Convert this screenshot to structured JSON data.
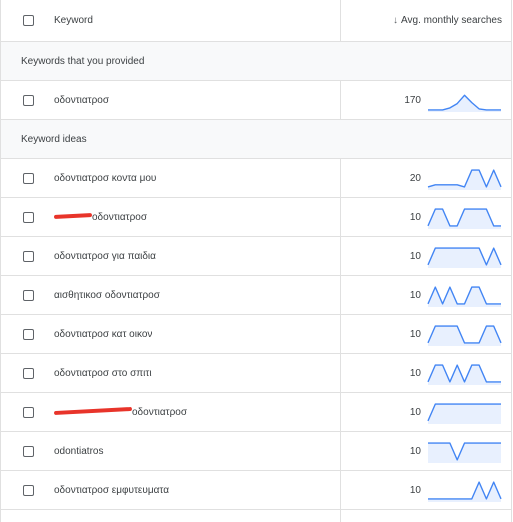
{
  "header": {
    "keyword_label": "Keyword",
    "sort_icon": "arrow-down-icon",
    "volume_label": "Avg. monthly searches"
  },
  "groups": [
    {
      "label": "Keywords that you provided"
    },
    {
      "label": "Keyword ideas"
    }
  ],
  "rows": [
    {
      "keyword": "οδοντιατροσ",
      "volume": "170",
      "trend": [
        0.05,
        0.05,
        0.05,
        0.15,
        0.35,
        0.75,
        0.4,
        0.1,
        0.05,
        0.05,
        0.05
      ]
    },
    {
      "keyword": "οδοντιατροσ κοντα μου",
      "volume": "20",
      "trend": [
        0.1,
        0.2,
        0.2,
        0.2,
        0.2,
        0.1,
        0.9,
        0.9,
        0.1,
        0.9,
        0.1
      ]
    },
    {
      "keyword": "οδοντιατροσ",
      "redacted": true,
      "volume": "10",
      "trend": [
        0.1,
        0.9,
        0.9,
        0.1,
        0.1,
        0.9,
        0.9,
        0.9,
        0.9,
        0.1,
        0.1
      ]
    },
    {
      "keyword": "οδοντιατροσ για παιδια",
      "volume": "10",
      "trend": [
        0.1,
        0.9,
        0.9,
        0.9,
        0.9,
        0.9,
        0.9,
        0.9,
        0.1,
        0.9,
        0.1
      ]
    },
    {
      "keyword": "αισθητικοσ οδοντιατροσ",
      "volume": "10",
      "trend": [
        0.1,
        0.9,
        0.1,
        0.9,
        0.1,
        0.1,
        0.9,
        0.9,
        0.1,
        0.1,
        0.1
      ]
    },
    {
      "keyword": "οδοντιατροσ κατ οικον",
      "volume": "10",
      "trend": [
        0.1,
        0.9,
        0.9,
        0.9,
        0.9,
        0.1,
        0.1,
        0.1,
        0.9,
        0.9,
        0.1
      ]
    },
    {
      "keyword": "οδοντιατροσ στο σπιτι",
      "volume": "10",
      "trend": [
        0.1,
        0.9,
        0.9,
        0.1,
        0.9,
        0.1,
        0.9,
        0.9,
        0.1,
        0.1,
        0.1
      ]
    },
    {
      "keyword": "οδοντιατροσ",
      "redacted": true,
      "redact_long": true,
      "volume": "10",
      "trend": [
        0.1,
        0.9,
        0.9,
        0.9,
        0.9,
        0.9,
        0.9,
        0.9,
        0.9,
        0.9,
        0.9
      ]
    },
    {
      "keyword": "odontiatros",
      "volume": "10",
      "trend": [
        0.9,
        0.9,
        0.9,
        0.9,
        0.1,
        0.9,
        0.9,
        0.9,
        0.9,
        0.9,
        0.9
      ]
    },
    {
      "keyword": "οδοντιατροσ εμφυτευματα",
      "volume": "10",
      "trend": [
        0.1,
        0.1,
        0.1,
        0.1,
        0.1,
        0.1,
        0.1,
        0.9,
        0.1,
        0.9,
        0.1
      ]
    }
  ],
  "colors": {
    "sparkline": "#4285f4",
    "sparkfill": "#e8f0fe",
    "redaction": "#e8342a"
  }
}
